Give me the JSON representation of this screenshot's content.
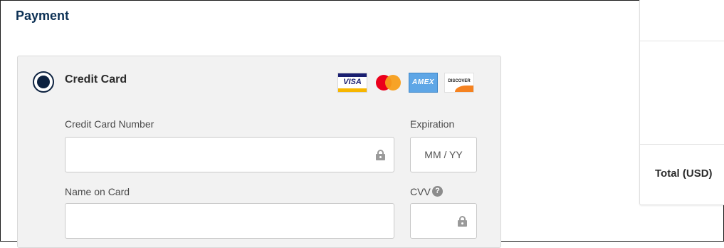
{
  "section": {
    "title": "Payment"
  },
  "payment_method": {
    "label": "Credit Card",
    "selected": true,
    "accepted_cards": [
      {
        "name": "Visa",
        "text": "VISA",
        "color": "#1a1f71"
      },
      {
        "name": "Mastercard",
        "color": "#eb001b"
      },
      {
        "name": "American Express",
        "text": "AMEX",
        "color": "#5ea6e6"
      },
      {
        "name": "Discover",
        "text": "DISCOVER",
        "color": "#f58220"
      }
    ]
  },
  "form": {
    "card_number": {
      "label": "Credit Card Number",
      "value": "",
      "placeholder": ""
    },
    "expiration": {
      "label": "Expiration",
      "value": "",
      "placeholder": "MM / YY"
    },
    "name_on_card": {
      "label": "Name on Card",
      "value": "",
      "placeholder": ""
    },
    "cvv": {
      "label": "CVV",
      "value": "",
      "placeholder": "",
      "help_glyph": "?"
    }
  },
  "summary": {
    "total_label": "Total (USD)"
  },
  "colors": {
    "heading": "#0d3155",
    "radio": "#0d2240",
    "panel_bg": "#f2f2f2"
  }
}
